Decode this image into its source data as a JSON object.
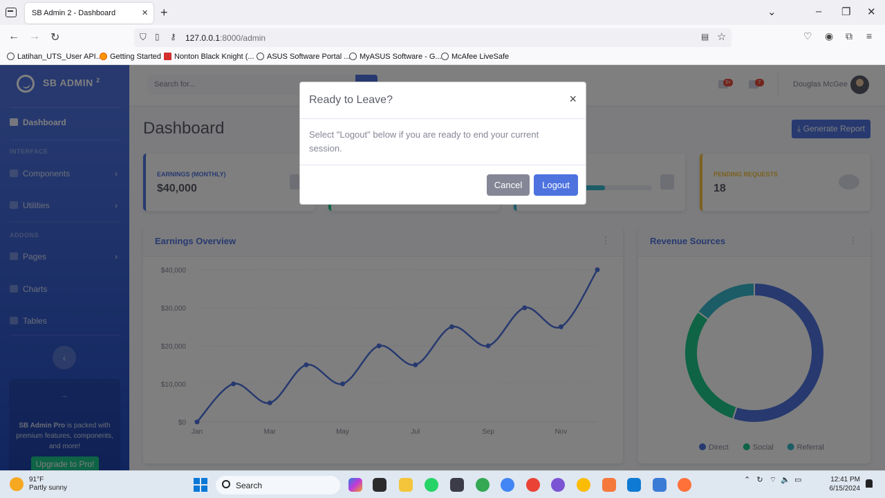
{
  "browser": {
    "tab_title": "SB Admin 2 - Dashboard",
    "url_host": "127.0.0.1",
    "url_rest": ":8000/admin",
    "bookmarks": [
      {
        "label": "Latihan_UTS_User API..."
      },
      {
        "label": "Getting Started"
      },
      {
        "label": "Nonton Black Knight (..."
      },
      {
        "label": "ASUS Software Portal ..."
      },
      {
        "label": "MyASUS Software - G..."
      },
      {
        "label": "McAfee LiveSafe"
      }
    ]
  },
  "sidebar": {
    "brand": "SB ADMIN",
    "brand_sup": "2",
    "heading_interface": "INTERFACE",
    "heading_addons": "ADDONS",
    "items": [
      {
        "label": "Dashboard"
      },
      {
        "label": "Components"
      },
      {
        "label": "Utilities"
      },
      {
        "label": "Pages"
      },
      {
        "label": "Charts"
      },
      {
        "label": "Tables"
      }
    ],
    "promo": {
      "dots": "...",
      "brand": "SB Admin Pro",
      "text": " is packed with premium features, components, and more!",
      "button": "Upgrade to Pro!"
    }
  },
  "topbar": {
    "search_placeholder": "Search for...",
    "alerts_badge": "3+",
    "messages_badge": "7",
    "username": "Douglas McGee"
  },
  "page": {
    "title": "Dashboard",
    "generate_report": "Generate Report"
  },
  "stats": {
    "earnings_label": "EARNINGS (MONTHLY)",
    "earnings_value": "$40,000",
    "pending_label": "PENDING REQUESTS",
    "pending_value": "18",
    "tasks_progress": 0.5
  },
  "cards": {
    "earnings_overview": "Earnings Overview",
    "revenue_sources": "Revenue Sources"
  },
  "chart_data": [
    {
      "type": "line",
      "title": "Earnings Overview",
      "x": [
        "Jan",
        "Feb",
        "Mar",
        "Apr",
        "May",
        "Jun",
        "Jul",
        "Aug",
        "Sep",
        "Oct",
        "Nov",
        "Dec"
      ],
      "x_tick_labels": [
        "Jan",
        "Mar",
        "May",
        "Jul",
        "Sep",
        "Nov"
      ],
      "y": [
        0,
        10000,
        5000,
        15000,
        10000,
        20000,
        15000,
        25000,
        20000,
        30000,
        25000,
        40000
      ],
      "y_tick_labels": [
        "$0",
        "$10,000",
        "$20,000",
        "$30,000",
        "$40,000"
      ],
      "ylim": [
        0,
        40000
      ],
      "color": "#4e73df",
      "grid": true
    },
    {
      "type": "pie",
      "title": "Revenue Sources",
      "series": [
        {
          "name": "Direct",
          "value": 55,
          "color": "#4e73df"
        },
        {
          "name": "Social",
          "value": 30,
          "color": "#1cc88a"
        },
        {
          "name": "Referral",
          "value": 15,
          "color": "#36b9cc"
        }
      ],
      "legend": "bottom"
    }
  ],
  "modal": {
    "title": "Ready to Leave?",
    "close": "×",
    "body": "Select \"Logout\" below if you are ready to end your current session.",
    "cancel": "Cancel",
    "logout": "Logout"
  },
  "taskbar": {
    "temp": "91°F",
    "weather": "Partly sunny",
    "search": "Search",
    "time": "12:41 PM",
    "date": "6/15/2024"
  }
}
